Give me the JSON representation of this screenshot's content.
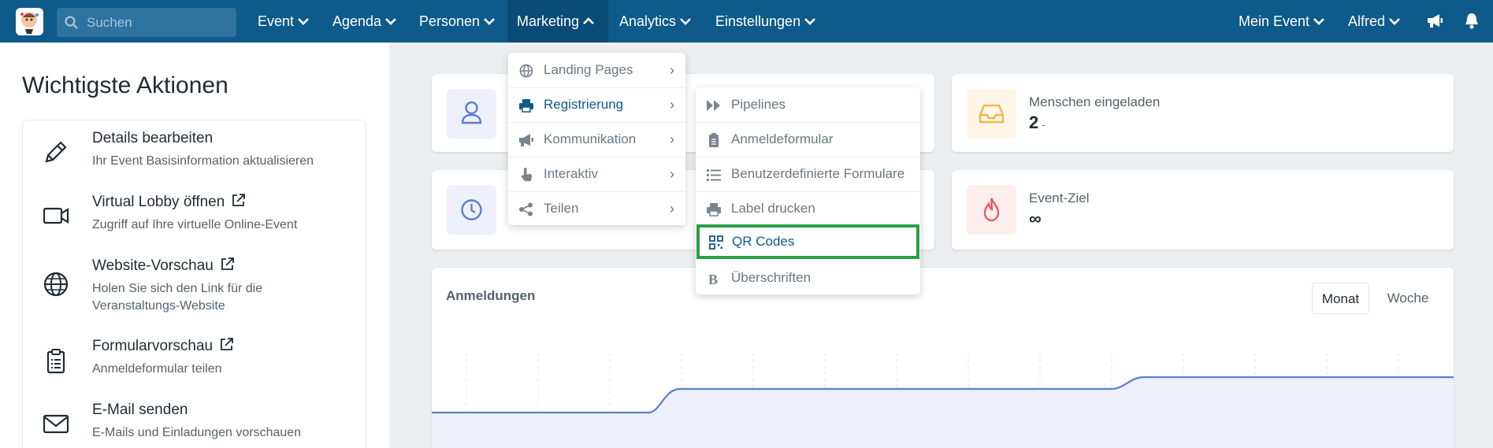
{
  "search": {
    "placeholder": "Suchen",
    "icon": "search-icon"
  },
  "nav": {
    "items": [
      {
        "label": "Event",
        "icon": "chevron-down-icon"
      },
      {
        "label": "Agenda",
        "icon": "chevron-down-icon"
      },
      {
        "label": "Personen",
        "icon": "chevron-down-icon"
      },
      {
        "label": "Marketing",
        "icon": "chevron-up-icon",
        "active": true
      },
      {
        "label": "Analytics",
        "icon": "chevron-down-icon"
      },
      {
        "label": "Einstellungen",
        "icon": "chevron-down-icon"
      }
    ],
    "right": [
      {
        "label": "Mein Event",
        "icon": "chevron-down-icon"
      },
      {
        "label": "Alfred",
        "icon": "chevron-down-icon"
      }
    ],
    "icons": [
      "megaphone-icon",
      "bell-icon"
    ]
  },
  "left": {
    "title": "Wichtigste Aktionen",
    "actions": [
      {
        "title": "Details bearbeiten",
        "subtitle": "Ihr Event Basisinformation aktualisieren",
        "icon": "pencil-icon",
        "external": false
      },
      {
        "title": "Virtual Lobby öffnen",
        "subtitle": "Zugriff auf Ihre virtuelle Online-Event",
        "icon": "video-camera-icon",
        "external": true
      },
      {
        "title": "Website-Vorschau",
        "subtitle": "Holen Sie sich den Link für die Veranstaltungs-Website",
        "icon": "globe-icon",
        "external": true
      },
      {
        "title": "Formularvorschau",
        "subtitle": "Anmeldeformular teilen",
        "icon": "clipboard-icon",
        "external": true
      },
      {
        "title": "E-Mail senden",
        "subtitle": "E-Mails und Einladungen vorschauen",
        "icon": "envelope-icon",
        "external": false
      }
    ]
  },
  "stats": {
    "invited": {
      "label": "Menschen eingeladen",
      "value": "2",
      "suffix": "-",
      "icon": "inbox-icon"
    },
    "goal": {
      "label": "Event-Ziel",
      "value": "∞",
      "icon": "fire-icon"
    }
  },
  "chart": {
    "title": "Anmeldungen",
    "toggle": [
      "Monat",
      "Woche"
    ],
    "accent": "#5b7fcf",
    "fill": "#eef1fc"
  },
  "marketing_menu": {
    "items": [
      {
        "label": "Landing Pages",
        "icon": "globe-icon",
        "arrow": "›"
      },
      {
        "label": "Registrierung",
        "icon": "printer-icon",
        "arrow": "›",
        "selected": true
      },
      {
        "label": "Kommunikation",
        "icon": "megaphone-icon",
        "arrow": "›"
      },
      {
        "label": "Interaktiv",
        "icon": "pointer-hand-icon",
        "arrow": "›"
      },
      {
        "label": "Teilen",
        "icon": "share-icon",
        "arrow": "›"
      }
    ]
  },
  "registration_menu": {
    "items": [
      {
        "label": "Pipelines",
        "icon": "fast-forward-icon"
      },
      {
        "label": "Anmeldeformular",
        "icon": "clipboard-icon"
      },
      {
        "label": "Benutzerdefinierte Formulare",
        "icon": "list-icon"
      },
      {
        "label": "Label drucken",
        "icon": "printer-icon"
      },
      {
        "label": "QR Codes",
        "icon": "qr-code-icon",
        "highlight": true
      },
      {
        "label": "Überschriften",
        "icon": "bold-icon"
      }
    ]
  },
  "colors": {
    "nav": "#0e5a8a",
    "nav_active": "#0a4c78",
    "highlight": "#27a047"
  }
}
